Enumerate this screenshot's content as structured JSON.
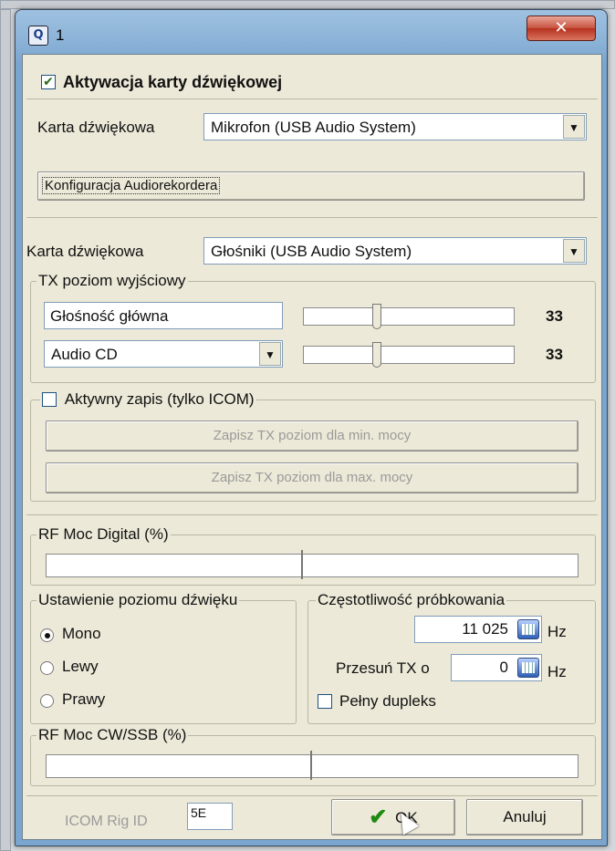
{
  "window": {
    "title": "1",
    "close_glyph": "✕"
  },
  "activation": {
    "checked": true,
    "label": "Aktywacja karty dźwiękowej"
  },
  "input_card": {
    "label": "Karta dźwiękowa",
    "value": "Mikrofon (USB Audio System)"
  },
  "audiorecorder_button": "Konfiguracja Audiorekordera",
  "output_card": {
    "label": "Karta dźwiękowa",
    "value": "Głośniki (USB Audio System)"
  },
  "tx_level": {
    "title": "TX poziom wyjściowy",
    "main_volume": {
      "label": "Głośność główna",
      "value": "33",
      "level": 0.33
    },
    "source": {
      "value": "Audio CD",
      "value_num": "33",
      "level": 0.33
    }
  },
  "active_save": {
    "checked": false,
    "label": "Aktywny zapis (tylko ICOM)",
    "save_min": "Zapisz TX poziom dla min. mocy",
    "save_max": "Zapisz TX poziom dla max. mocy"
  },
  "rf_digital": {
    "title": "RF Moc Digital (%)"
  },
  "sound_setting": {
    "title": "Ustawienie poziomu dźwięku",
    "options": [
      "Mono",
      "Lewy",
      "Prawy"
    ],
    "selected": "Mono"
  },
  "sampling": {
    "title": "Częstotliwość próbkowania",
    "rate": "11 025",
    "rate_unit": "Hz",
    "shift_label": "Przesuń TX o",
    "shift_value": "0",
    "shift_unit": "Hz",
    "full_duplex": {
      "checked": false,
      "label": "Pełny dupleks"
    }
  },
  "rf_cw_ssb": {
    "title": "RF Moc CW/SSB (%)"
  },
  "footer": {
    "rig_label": "ICOM Rig ID",
    "rig_value": "5E",
    "ok_label": "OK",
    "cancel_label": "Anuluj"
  }
}
